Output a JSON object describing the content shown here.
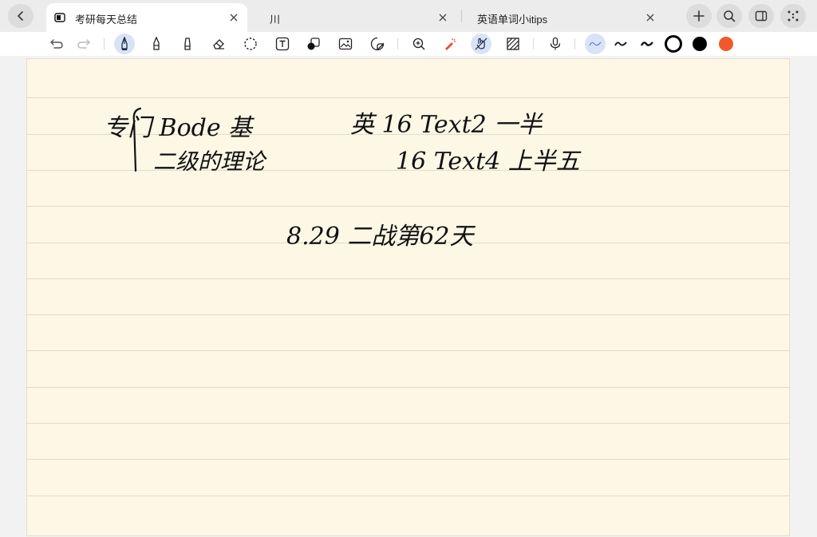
{
  "tabs": [
    {
      "label": "考研每天总结",
      "active": true,
      "icon": "document-icon"
    },
    {
      "label": "川",
      "active": false
    },
    {
      "label": "英语单词小itips",
      "active": false
    }
  ],
  "tabbar_actions": [
    "back-icon",
    "add-icon",
    "search-icon",
    "sidebar-icon",
    "apps-icon"
  ],
  "toolbar": {
    "tools": [
      "undo-icon",
      "redo-icon",
      "pen-icon",
      "pencil-icon",
      "highlighter-icon",
      "eraser-icon",
      "lasso-icon",
      "text-box-icon",
      "shapes-icon",
      "image-icon",
      "sticker-icon",
      "zoom-icon",
      "laser-pointer-icon",
      "hand-draw-icon",
      "ruler-pattern-icon",
      "microphone-icon"
    ],
    "stroke_presets": [
      "stroke-thin-icon",
      "stroke-medium-icon",
      "stroke-thick-icon"
    ],
    "colors": [
      "#000000",
      "#000000",
      "#f05a2a"
    ]
  },
  "handwriting": {
    "line1_left": "专门 Bode 基",
    "line1_right": "英 16 Text2 一半",
    "line2_left": "二级的理论",
    "line2_right": "16 Text4 上半五",
    "center": "8.29 二战第62天"
  }
}
